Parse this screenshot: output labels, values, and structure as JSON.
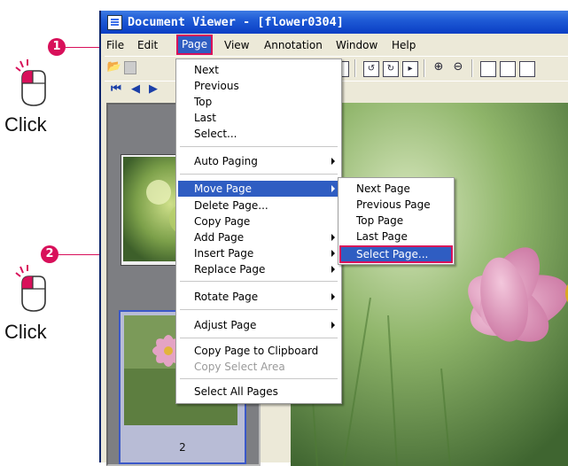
{
  "window": {
    "title": "Document Viewer - [flower0304]"
  },
  "menubar": {
    "items": [
      {
        "label": "File"
      },
      {
        "label": "Edit"
      },
      {
        "label": "Page"
      },
      {
        "label": "View"
      },
      {
        "label": "Annotation"
      },
      {
        "label": "Window"
      },
      {
        "label": "Help"
      }
    ]
  },
  "page_menu": {
    "items": [
      {
        "label": "Next"
      },
      {
        "label": "Previous"
      },
      {
        "label": "Top"
      },
      {
        "label": "Last"
      },
      {
        "label": "Select..."
      },
      {
        "label": "Auto Paging"
      },
      {
        "label": "Move Page"
      },
      {
        "label": "Delete Page..."
      },
      {
        "label": "Copy Page"
      },
      {
        "label": "Add Page"
      },
      {
        "label": "Insert Page"
      },
      {
        "label": "Replace Page"
      },
      {
        "label": "Rotate Page"
      },
      {
        "label": "Adjust Page"
      },
      {
        "label": "Copy Page to Clipboard"
      },
      {
        "label": "Copy Select Area"
      },
      {
        "label": "Select All Pages"
      }
    ]
  },
  "move_page_submenu": {
    "items": [
      {
        "label": "Next Page"
      },
      {
        "label": "Previous Page"
      },
      {
        "label": "Top Page"
      },
      {
        "label": "Last Page"
      },
      {
        "label": "Select Page..."
      }
    ]
  },
  "thumbnails": {
    "page_number": "2"
  },
  "annotations": {
    "step1": "1",
    "step2": "2",
    "click_label": "Click"
  },
  "colors": {
    "callout": "#d8105a",
    "highlight": "#2f5dc2"
  },
  "icons": [
    "app-document-icon",
    "open-folder-icon",
    "save-icon",
    "first-page-icon",
    "previous-page-icon",
    "rotate-left-icon",
    "rotate-right-icon",
    "fit-page-icon",
    "zoom-in-icon",
    "zoom-out-icon",
    "single-page-icon",
    "two-page-icon",
    "mouse-left-click-icon"
  ]
}
